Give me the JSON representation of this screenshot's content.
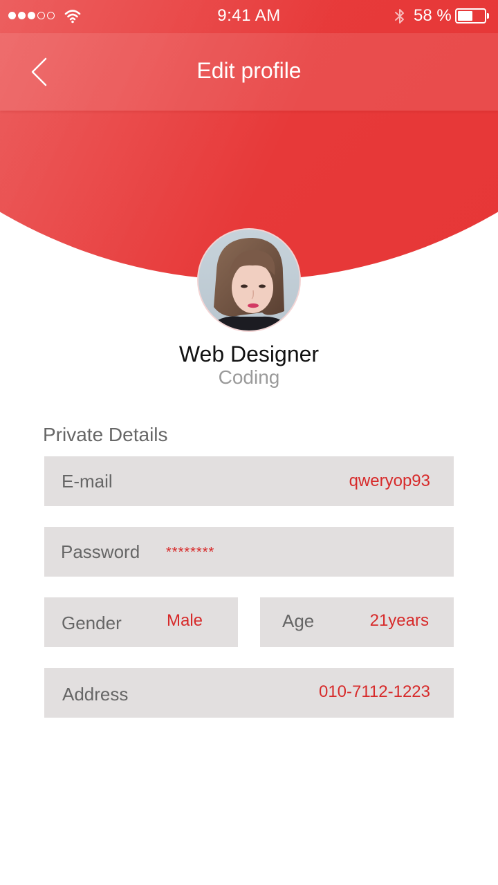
{
  "status_bar": {
    "time": "9:41 AM",
    "battery_percent": "58 %",
    "battery_level": 0.58
  },
  "nav": {
    "title": "Edit profile"
  },
  "profile": {
    "name": "Web Designer",
    "role": "Coding"
  },
  "private_details": {
    "title": "Private Details",
    "email": {
      "label": "E-mail",
      "value": "qweryop93"
    },
    "password": {
      "label": "Password",
      "value": "********"
    },
    "gender": {
      "label": "Gender",
      "value": "Male"
    },
    "age": {
      "label": "Age",
      "value": "21years"
    },
    "address": {
      "label": "Address",
      "value": "010-7112-1223"
    }
  },
  "colors": {
    "accent": "#e63535",
    "value_red": "#d72a2a",
    "field_bg": "#e2dfdf"
  }
}
